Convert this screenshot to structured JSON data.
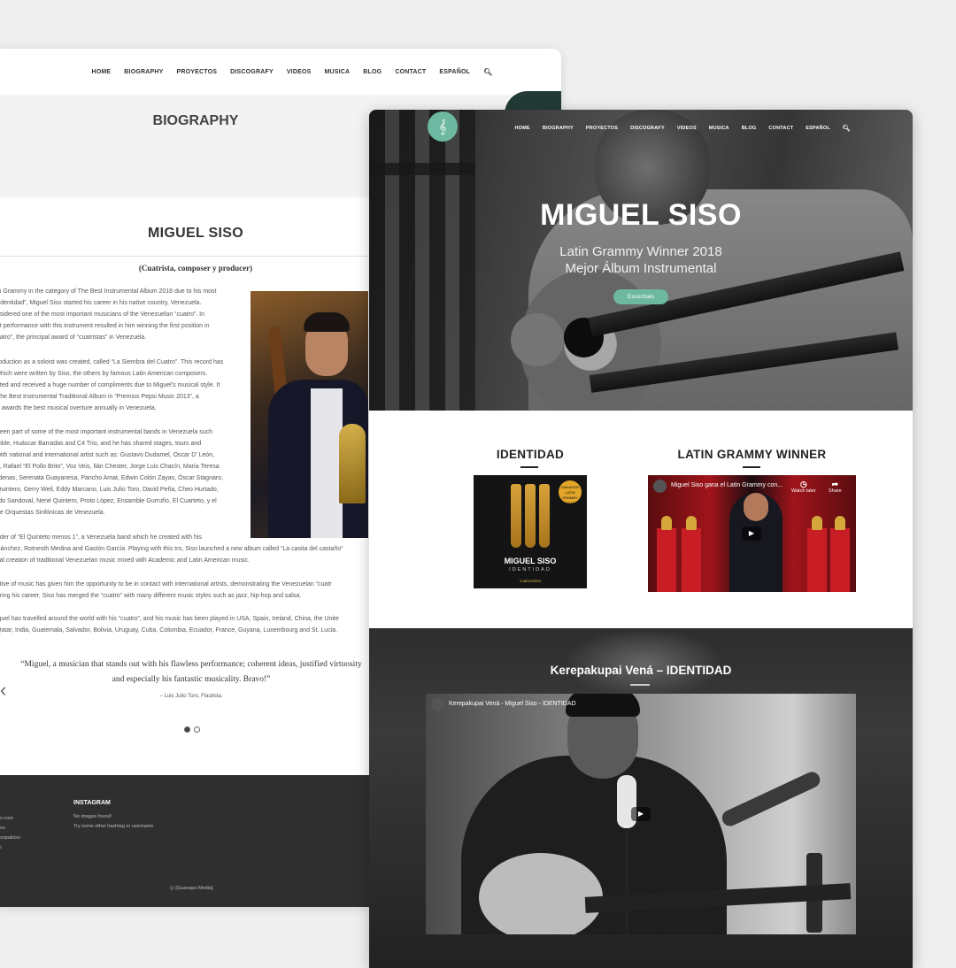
{
  "back": {
    "nav": [
      "HOME",
      "BIOGRAPHY",
      "PROYECTOS",
      "DISCOGRAFY",
      "VIDEOS",
      "MUSICA",
      "BLOG",
      "CONTACT",
      "ESPAÑOL"
    ],
    "page_title": "BIOGRAPHY",
    "name": "MIGUEL SISO",
    "subtitle": "(Cuatrista, composer y producer)",
    "paragraphs": [
      [
        "in Grammy in the category of The Best Instrumental Album 2018 due to his most",
        "“Identidad”, Miguel Siso started his career in his native country, Venezuela.",
        "nsidered one of the most important musicians of the Venezuelan “cuatro”. In",
        "nt performance with this instrument resulted in him winning the first position in",
        "uatro”, the principal award of “cuatristas” in Venezuela."
      ],
      [
        "roduction as a soloist was created, called “La Siembra del Cuatro”. This record has",
        "which were written by Siso, the others by famous Latin American composers.",
        "oted and received a huge number of compliments due to Miguel’s musical style. It",
        "The Best Instrumental Traditional Album in “Premios Pepsi Music 2013”, a",
        "n awards the best musical overture annually in Venezuela."
      ],
      [
        "been part of some of the most important instrumental bands in Venezuela such",
        "mble, Huáscar Barradas and C4 Trio, and he has shared stages, tours and",
        "with national and international artist such as: Gustavo Dudamel, Oscar D’ León,",
        "e, Rafael “El Pollo Brito”, Voz Veis, Ilán Chester, Jorge Luis Chacín, María Teresa",
        "rdenas, Serenata Guayanesa, Pancho Amat, Edwin Colón Zayas, Óscar Stagnaro,",
        "Quintero, Gerry Weil, Eddy Marcano, Luis Julio Toro, David Peña, Cheo Hurtado,",
        "rdo Sandoval, Nené Quintero, Proto López, Ensamble Gurrufío, El Cuarteto, y el",
        "de Orquestas Sinfónicas de Venezuela."
      ],
      [
        "nder of “El Quinteto menos 1”, a Venezuela band which he created with his",
        "Sánchez, Rotnesth Medina and Gastón García. Playing with this tro, Siso launched a new album called “La casita del castaño”",
        "cal creation of traditional Venezuelan music mixed with Academic and Latin American music."
      ],
      [
        "ctive of music has given him the opportunity to be in contact with international artists, demonstrating the Venezuelan “cuatr",
        "uring his career, Siso has merged the “cuatro” with many different music styles such as jazz, hip-hop and salsa."
      ],
      [
        "iguel has travelled around the world with his “cuatro”, and his music has been played in USA, Spain, Ireland, China, the Unite",
        "Qatar, India, Guatemala, Salvador, Bolivia, Uruguay, Cuba, Colombia, Ecuador, France, Guyana, Luxembourg and St. Lucia."
      ]
    ],
    "quote": [
      "“Miguel, a musician that stands out with his flawless performance; coherent ideas, justified virtuosity",
      "and especially his fantastic musicality. Bravo!”"
    ],
    "quote_author": "– Luis Julio Toro, Flautista.",
    "footer": {
      "instagram_title": "INSTAGRAM",
      "instagram_lines": [
        "No images found!",
        "Try some other hashtag or username"
      ],
      "left_links": [
        "iso.com",
        "siso",
        "sisopalsiso",
        "so"
      ],
      "credit": "[Guanapo Media]"
    }
  },
  "front": {
    "logo": "𝄞",
    "nav": [
      "HOME",
      "BIOGRAPHY",
      "PROYECTOS",
      "DISCOGRAFY",
      "VIDEOS",
      "MUSICA",
      "BLOG",
      "CONTACT",
      "ESPAÑOL"
    ],
    "hero_title": "MIGUEL SISO",
    "hero_sub1": "Latin Grammy Winner 2018",
    "hero_sub2": "Mejor Álbum Instrumental",
    "hero_button": "Escúchalo",
    "section1_title": "IDENTIDAD",
    "section2_title": "LATIN GRAMMY WINNER",
    "album": {
      "title": "MIGUEL SISO",
      "subtitle": "IDENTIDAD",
      "badge": "GANADOR LATIN GRAMMY 2018",
      "label": "cuatrovision"
    },
    "video1": {
      "title": "Miguel Siso gana el Latin Grammy con...",
      "watch_later": "Watch later",
      "share": "Share"
    },
    "section3_title": "Kerepakupai Vená – IDENTIDAD",
    "video2": {
      "title": "Kerepakupai Vená - Miguel Siso - IDENTIDAD"
    },
    "colors": {
      "accent": "#6cb8a0",
      "footer": "#2f2f2f"
    }
  }
}
